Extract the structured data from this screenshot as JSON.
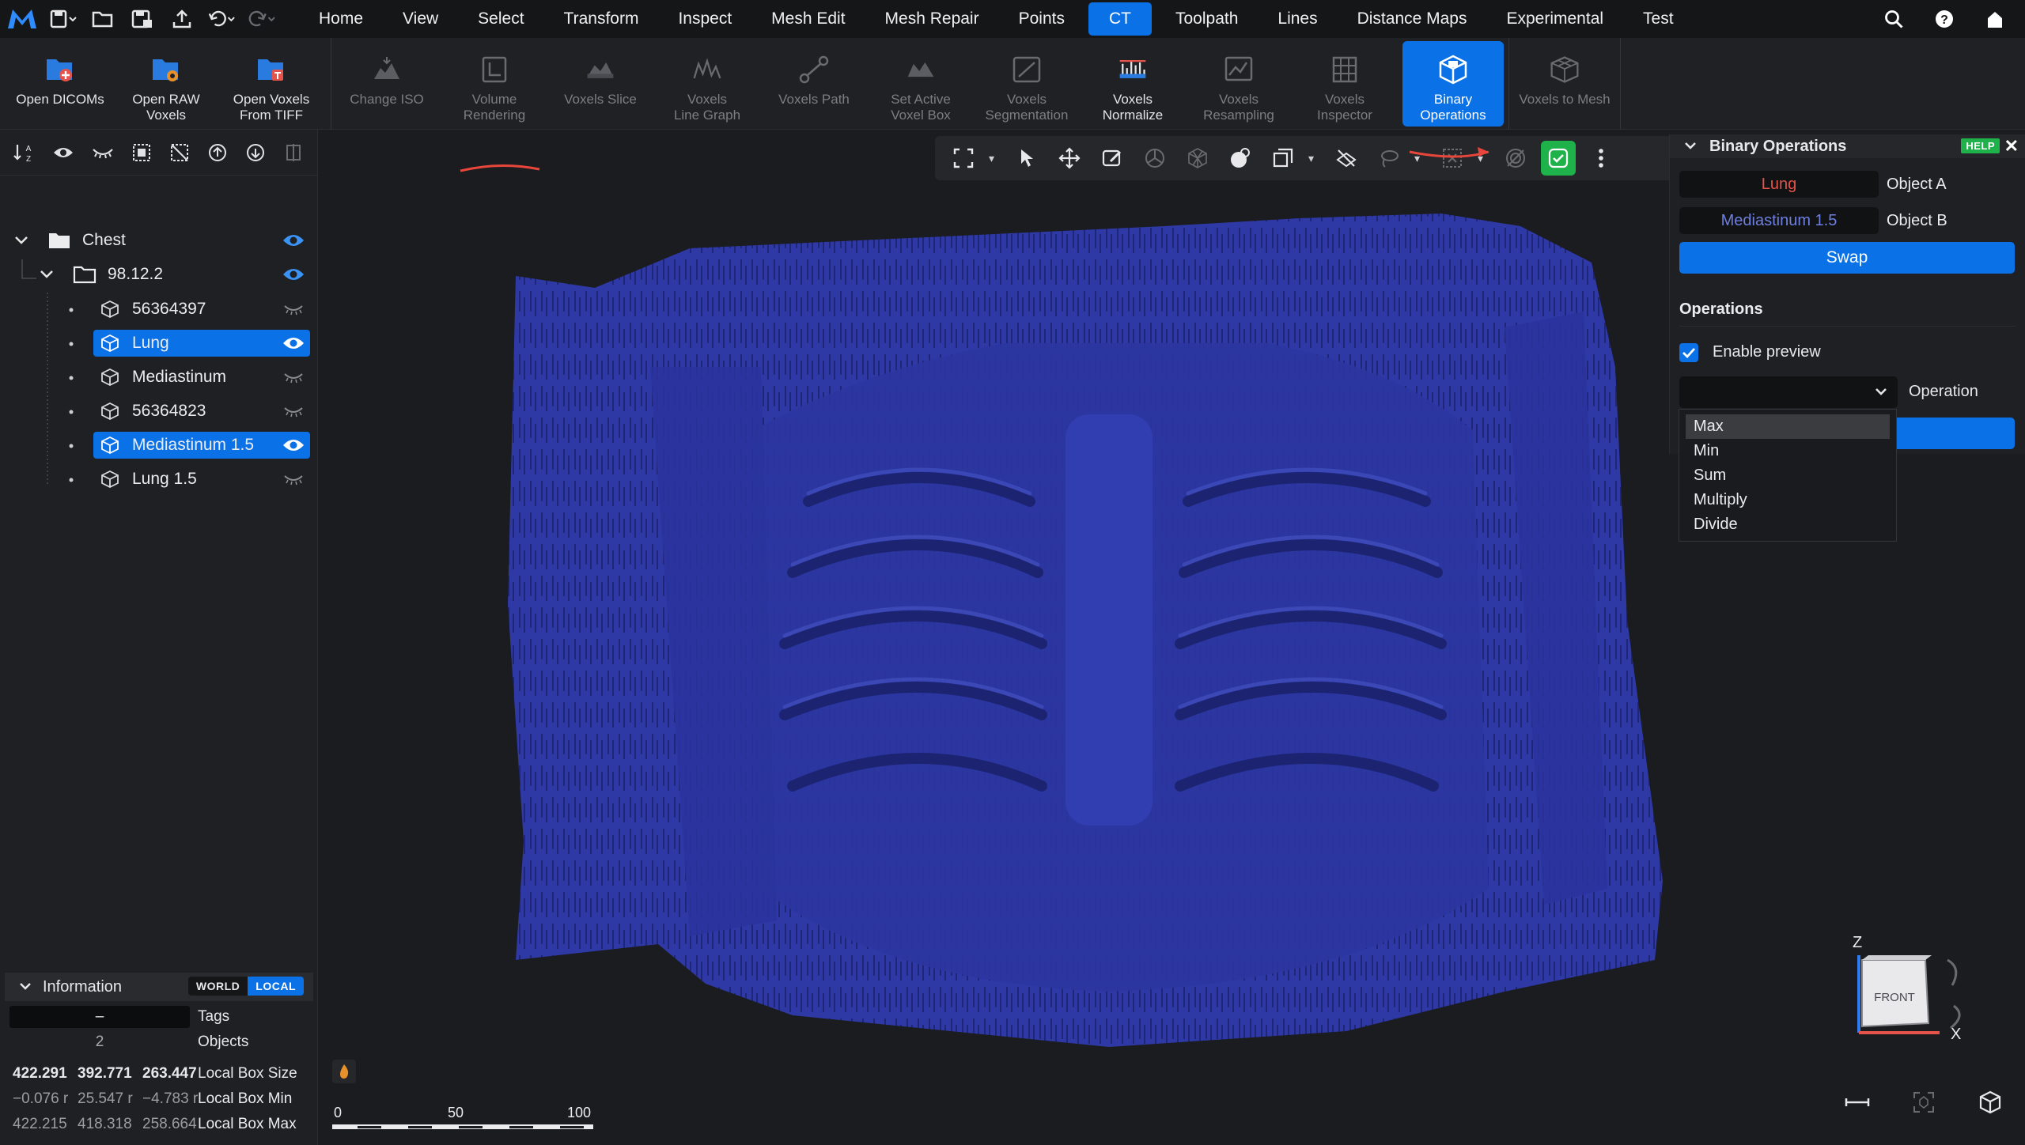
{
  "quick_access": {
    "icons": [
      "app-logo",
      "save-icon",
      "open-folder-icon",
      "save-as-icon",
      "export-icon",
      "undo-icon",
      "redo-icon"
    ]
  },
  "menu": {
    "items": [
      "Home",
      "View",
      "Select",
      "Transform",
      "Inspect",
      "Mesh Edit",
      "Mesh Repair",
      "Points",
      "CT",
      "Toolpath",
      "Lines",
      "Distance Maps",
      "Experimental",
      "Test"
    ],
    "active": "CT"
  },
  "ribbon": {
    "open_dicoms": "Open DICOMs",
    "open_raw_voxels": "Open RAW\nVoxels",
    "open_voxels_tiff": "Open Voxels\nFrom TIFF",
    "change_iso": "Change ISO",
    "volume_rendering": "Volume\nRendering",
    "voxels_slice": "Voxels Slice",
    "voxels_line_graph": "Voxels\nLine Graph",
    "voxels_path": "Voxels Path",
    "set_active_voxel_box": "Set Active\nVoxel Box",
    "voxels_segmentation": "Voxels\nSegmentation",
    "voxels_normalize": "Voxels\nNormalize",
    "voxels_resampling": "Voxels\nResampling",
    "voxels_inspector": "Voxels\nInspector",
    "binary_operations": "Binary\nOperations",
    "voxels_to_mesh": "Voxels to Mesh"
  },
  "tree": {
    "root": "Chest",
    "group": "98.12.2",
    "items": [
      {
        "label": "56364397",
        "selected": false,
        "visible": false
      },
      {
        "label": "Lung",
        "selected": true,
        "visible": true
      },
      {
        "label": "Mediastinum",
        "selected": false,
        "visible": false
      },
      {
        "label": "56364823",
        "selected": false,
        "visible": false
      },
      {
        "label": "Mediastinum 1.5",
        "selected": true,
        "visible": true
      },
      {
        "label": "Lung 1.5",
        "selected": false,
        "visible": false
      }
    ]
  },
  "information": {
    "title": "Information",
    "world": "WORLD",
    "local": "LOCAL",
    "tags_value": "–",
    "tags_label": "Tags",
    "objects_value": "2",
    "objects_label": "Objects",
    "box_size": [
      "422.291",
      "392.771",
      "263.447"
    ],
    "box_size_label": "Local Box Size",
    "box_min": [
      "−0.076 r",
      "25.547 r",
      "−4.783 r"
    ],
    "box_min_label": "Local Box Min",
    "box_max": [
      "422.215",
      "418.318",
      "258.664"
    ],
    "box_max_label": "Local Box Max"
  },
  "binary_panel": {
    "title": "Binary Operations",
    "help": "HELP",
    "object_a_value": "Lung",
    "object_a_label": "Object A",
    "object_a_color": "#e5534b",
    "object_b_value": "Mediastinum 1.5",
    "object_b_label": "Object B",
    "object_b_color": "#6f7fe0",
    "swap_label": "Swap",
    "operations_section": "Operations",
    "enable_preview_label": "Enable preview",
    "enable_preview_checked": true,
    "operation_label": "Operation",
    "operation_value": ""
  },
  "operation_dropdown": {
    "options": [
      "Max",
      "Min",
      "Sum",
      "Multiply",
      "Divide"
    ],
    "highlighted": "Max"
  },
  "scale_bar": {
    "ticks": [
      "0",
      "50",
      "100"
    ]
  },
  "orientation_cube": {
    "face": "FRONT",
    "axis_z": "Z",
    "axis_x": "X"
  },
  "colors": {
    "accent": "#0a72e6",
    "volume": "#2e39a6",
    "help_green": "#1fb24a"
  }
}
